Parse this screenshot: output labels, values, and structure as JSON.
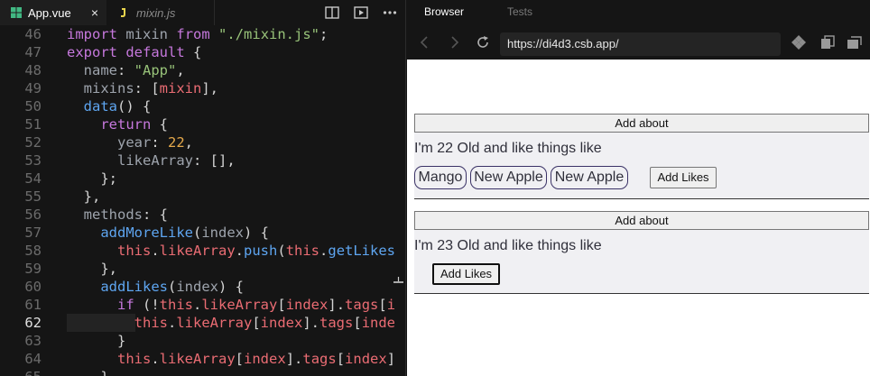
{
  "editor": {
    "tabs": [
      {
        "label": "App.vue",
        "icon": "vue-file-icon",
        "active": true
      },
      {
        "label": "mixin.js",
        "icon": "js-file-icon",
        "active": false
      }
    ],
    "close_glyph": "×",
    "active_line": 62
  },
  "code_lines": [
    {
      "n": "46",
      "segs": [
        [
          "k",
          "import"
        ],
        [
          "o",
          " "
        ],
        [
          "p",
          "mixin"
        ],
        [
          "o",
          " "
        ],
        [
          "k",
          "from"
        ],
        [
          "o",
          " "
        ],
        [
          "s",
          "\"./mixin.js\""
        ],
        [
          "o",
          ";"
        ]
      ]
    },
    {
      "n": "47",
      "segs": [
        [
          "k",
          "export"
        ],
        [
          "o",
          " "
        ],
        [
          "k",
          "default"
        ],
        [
          "o",
          " {"
        ]
      ]
    },
    {
      "n": "48",
      "segs": [
        [
          "o",
          "  "
        ],
        [
          "p",
          "name"
        ],
        [
          "o",
          ": "
        ],
        [
          "s",
          "\"App\""
        ],
        [
          "o",
          ","
        ]
      ]
    },
    {
      "n": "49",
      "segs": [
        [
          "o",
          "  "
        ],
        [
          "p",
          "mixins"
        ],
        [
          "o",
          ": ["
        ],
        [
          "t",
          "mixin"
        ],
        [
          "o",
          "],"
        ]
      ]
    },
    {
      "n": "50",
      "segs": [
        [
          "o",
          "  "
        ],
        [
          "f",
          "data"
        ],
        [
          "o",
          "() {"
        ]
      ]
    },
    {
      "n": "51",
      "segs": [
        [
          "o",
          "    "
        ],
        [
          "k",
          "return"
        ],
        [
          "o",
          " {"
        ]
      ]
    },
    {
      "n": "52",
      "segs": [
        [
          "o",
          "      "
        ],
        [
          "p",
          "year"
        ],
        [
          "o",
          ": "
        ],
        [
          "n",
          "22"
        ],
        [
          "o",
          ","
        ]
      ]
    },
    {
      "n": "53",
      "segs": [
        [
          "o",
          "      "
        ],
        [
          "p",
          "likeArray"
        ],
        [
          "o",
          ": [],"
        ]
      ]
    },
    {
      "n": "54",
      "segs": [
        [
          "o",
          "    };"
        ]
      ]
    },
    {
      "n": "55",
      "segs": [
        [
          "o",
          "  },"
        ]
      ]
    },
    {
      "n": "56",
      "segs": [
        [
          "o",
          "  "
        ],
        [
          "p",
          "methods"
        ],
        [
          "o",
          ": {"
        ]
      ]
    },
    {
      "n": "57",
      "segs": [
        [
          "o",
          "    "
        ],
        [
          "f",
          "addMoreLike"
        ],
        [
          "o",
          "("
        ],
        [
          "p",
          "index"
        ],
        [
          "o",
          ") {"
        ]
      ]
    },
    {
      "n": "58",
      "segs": [
        [
          "o",
          "      "
        ],
        [
          "t",
          "this"
        ],
        [
          "o",
          "."
        ],
        [
          "t",
          "likeArray"
        ],
        [
          "o",
          "."
        ],
        [
          "f",
          "push"
        ],
        [
          "o",
          "("
        ],
        [
          "t",
          "this"
        ],
        [
          "o",
          "."
        ],
        [
          "f",
          "getLikes"
        ]
      ]
    },
    {
      "n": "59",
      "segs": [
        [
          "o",
          "    },"
        ]
      ]
    },
    {
      "n": "60",
      "segs": [
        [
          "o",
          "    "
        ],
        [
          "f",
          "addLikes"
        ],
        [
          "o",
          "("
        ],
        [
          "p",
          "index"
        ],
        [
          "o",
          ") {"
        ]
      ]
    },
    {
      "n": "61",
      "segs": [
        [
          "o",
          "      "
        ],
        [
          "k",
          "if"
        ],
        [
          "o",
          " (!"
        ],
        [
          "t",
          "this"
        ],
        [
          "o",
          "."
        ],
        [
          "t",
          "likeArray"
        ],
        [
          "o",
          "["
        ],
        [
          "t",
          "index"
        ],
        [
          "o",
          "]."
        ],
        [
          "t",
          "tags"
        ],
        [
          "o",
          "["
        ],
        [
          "t",
          "i"
        ]
      ]
    },
    {
      "n": "62",
      "segs": [
        [
          "o",
          "        "
        ],
        [
          "t",
          "this"
        ],
        [
          "o",
          "."
        ],
        [
          "t",
          "likeArray"
        ],
        [
          "o",
          "["
        ],
        [
          "t",
          "index"
        ],
        [
          "o",
          "]."
        ],
        [
          "t",
          "tags"
        ],
        [
          "o",
          "["
        ],
        [
          "t",
          "inde"
        ]
      ]
    },
    {
      "n": "63",
      "segs": [
        [
          "o",
          "      }"
        ]
      ]
    },
    {
      "n": "64",
      "segs": [
        [
          "o",
          "      "
        ],
        [
          "t",
          "this"
        ],
        [
          "o",
          "."
        ],
        [
          "t",
          "likeArray"
        ],
        [
          "o",
          "["
        ],
        [
          "t",
          "index"
        ],
        [
          "o",
          "]."
        ],
        [
          "t",
          "tags"
        ],
        [
          "o",
          "["
        ],
        [
          "t",
          "index"
        ],
        [
          "o",
          "]"
        ]
      ]
    },
    {
      "n": "65",
      "segs": [
        [
          "o",
          "    },"
        ]
      ]
    }
  ],
  "browser": {
    "tabs": [
      "Browser",
      "Tests"
    ],
    "url": "https://di4d3.csb.app/",
    "cards": [
      {
        "about_label": "Add about",
        "age_text": "I'm 22 Old and like things like",
        "tags": [
          "Mango",
          "New Apple",
          "New Apple"
        ],
        "likes_label": "Add Likes"
      },
      {
        "about_label": "Add about",
        "age_text": "I'm 23 Old and like things like",
        "tags": [],
        "likes_label": "Add Likes"
      }
    ]
  },
  "colors": {
    "keyword": "#c678dd",
    "string": "#98c379",
    "number": "#e5a94b",
    "function": "#5ea5f0",
    "property": "#9ea4ad",
    "identifier": "#ea6c73",
    "vue_green": "#41b883",
    "js_yellow": "#e8d44d"
  }
}
